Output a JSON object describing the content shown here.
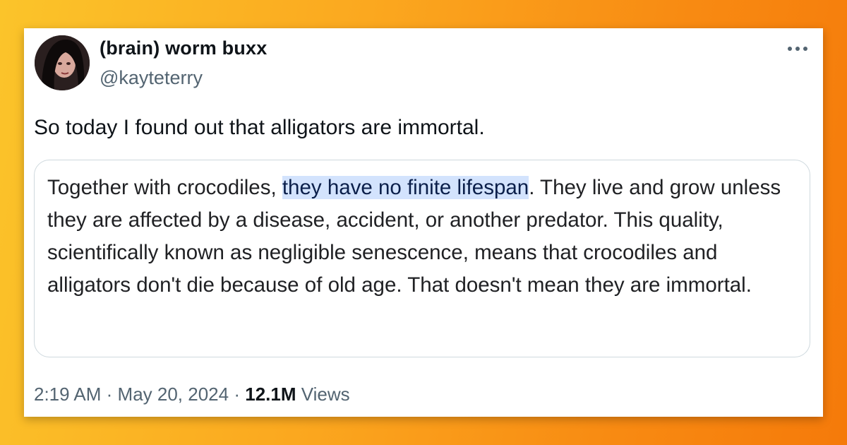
{
  "user": {
    "display_name": "(brain) worm buxx",
    "handle": "@kayteterry"
  },
  "tweet": {
    "text": "So today I found out that alligators are immortal."
  },
  "quote": {
    "before": "Together with crocodiles, ",
    "highlight": "they have no finite lifespan",
    "after": ". They live and grow unless they are affected by a disease, accident, or another predator. This quality, scientifically known as negligible senescence, means that crocodiles and alligators don't die because of old age. That doesn't mean they are immortal."
  },
  "meta": {
    "time": "2:19 AM",
    "separator": "·",
    "date": "May 20, 2024",
    "views_count": "12.1M",
    "views_label": "Views"
  },
  "icons": {
    "more": "more-horizontal-icon",
    "avatar": "avatar"
  },
  "colors": {
    "highlight_bg": "#d3e3fd",
    "secondary_text": "#536471",
    "primary_text": "#0f1419",
    "background_gradient_start": "#fbc42a",
    "background_gradient_end": "#f57a0a"
  }
}
